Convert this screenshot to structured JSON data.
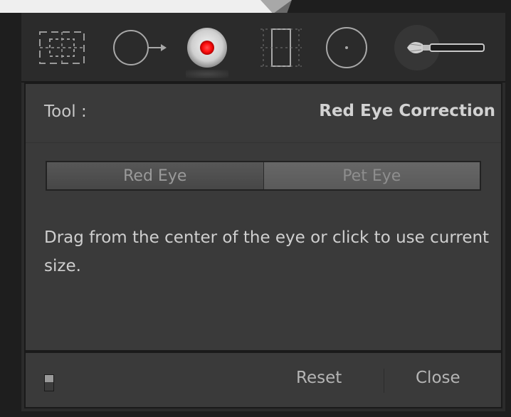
{
  "toolstrip": {
    "tools": [
      {
        "name": "crop-overlay",
        "icon": "crop-grid-icon"
      },
      {
        "name": "spot-removal",
        "icon": "spot-removal-icon"
      },
      {
        "name": "red-eye",
        "icon": "red-eye-icon",
        "active": true
      },
      {
        "name": "graduated-filter",
        "icon": "graduated-filter-icon"
      },
      {
        "name": "radial-filter",
        "icon": "radial-filter-icon"
      },
      {
        "name": "adjustment-brush",
        "icon": "adjustment-brush-icon"
      }
    ]
  },
  "panel": {
    "tool_label": "Tool :",
    "tool_value": "Red Eye Correction",
    "modes": {
      "red_eye": "Red Eye",
      "pet_eye": "Pet Eye",
      "selected": "Pet Eye"
    },
    "help_text": "Drag from the center of the eye or click to use current size."
  },
  "footer": {
    "reset_label": "Reset",
    "close_label": "Close"
  },
  "colors": {
    "panel_bg": "#3a3a3a",
    "red_eye_center": "#ff1a1a"
  }
}
